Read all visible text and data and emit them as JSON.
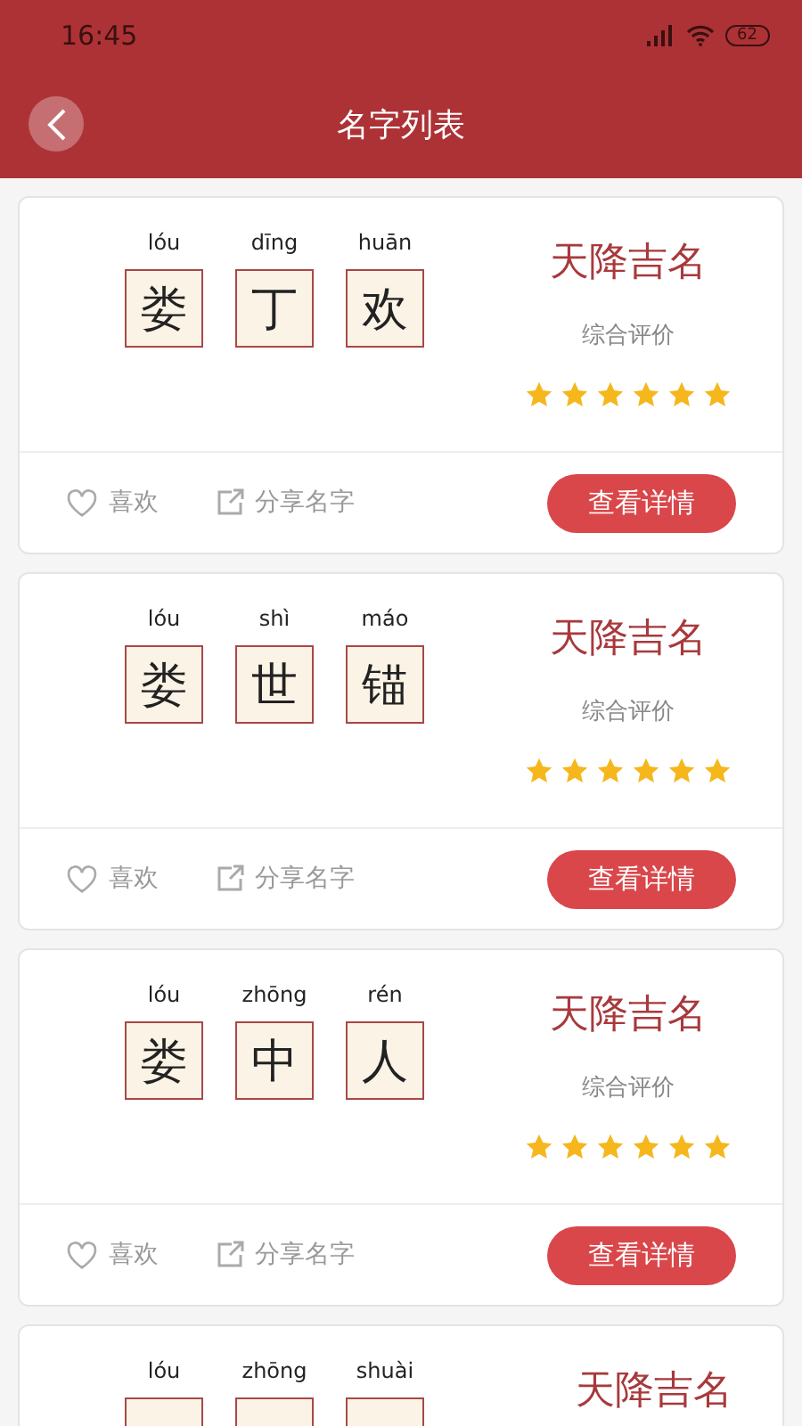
{
  "status_bar": {
    "time": "16:45",
    "battery": "62"
  },
  "header": {
    "title": "名字列表"
  },
  "names": [
    {
      "chars": [
        {
          "pinyin": "lóu",
          "char": "娄"
        },
        {
          "pinyin": "dīng",
          "char": "丁"
        },
        {
          "pinyin": "huān",
          "char": "欢"
        }
      ],
      "title": "天降吉名",
      "rating_label": "综合评价",
      "stars": 6,
      "like": "喜欢",
      "share": "分享名字",
      "details": "查看详情"
    },
    {
      "chars": [
        {
          "pinyin": "lóu",
          "char": "娄"
        },
        {
          "pinyin": "shì",
          "char": "世"
        },
        {
          "pinyin": "máo",
          "char": "锚"
        }
      ],
      "title": "天降吉名",
      "rating_label": "综合评价",
      "stars": 6,
      "like": "喜欢",
      "share": "分享名字",
      "details": "查看详情"
    },
    {
      "chars": [
        {
          "pinyin": "lóu",
          "char": "娄"
        },
        {
          "pinyin": "zhōng",
          "char": "中"
        },
        {
          "pinyin": "rén",
          "char": "人"
        }
      ],
      "title": "天降吉名",
      "rating_label": "综合评价",
      "stars": 6,
      "like": "喜欢",
      "share": "分享名字",
      "details": "查看详情"
    },
    {
      "chars": [
        {
          "pinyin": "lóu"
        },
        {
          "pinyin": "zhōng"
        },
        {
          "pinyin": "shuài"
        }
      ],
      "title": "天降吉名"
    }
  ]
}
